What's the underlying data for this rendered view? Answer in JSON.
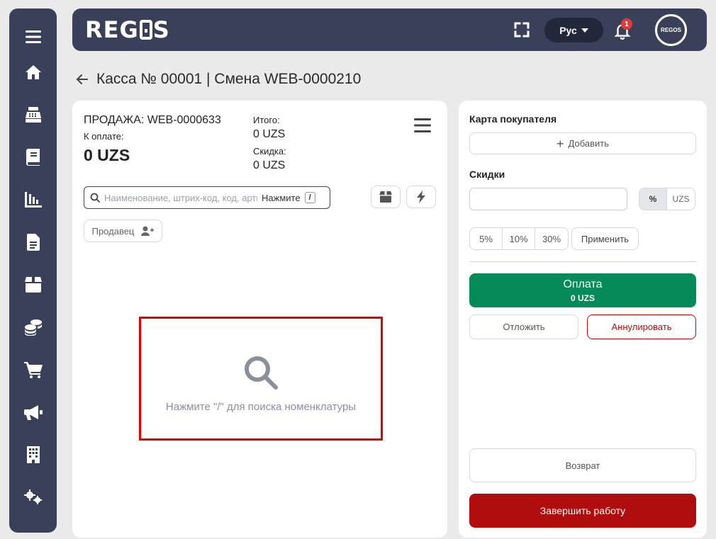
{
  "header": {
    "logo": "REG S",
    "language": "Рус",
    "notifications_count": "1",
    "avatar_text": "REGOS"
  },
  "page": {
    "title": "Касса № 00001 | Смена WEB-0000210"
  },
  "sale": {
    "number": "ПРОДАЖА: WEB-0000633",
    "to_pay_label": "К оплате:",
    "to_pay_value": "0 UZS",
    "total_label": "Итого:",
    "total_value": "0 UZS",
    "discount_label": "Скидка:",
    "discount_value": "0 UZS"
  },
  "search": {
    "placeholder": "Наименование, штрих-код, код, артикул",
    "hint": "Нажмите",
    "shortcut": "/"
  },
  "seller": {
    "label": "Продавец"
  },
  "empty_state": {
    "text": "Нажмите \"/\" для поиска номенклатуры"
  },
  "customer_card": {
    "label": "Карта покупателя",
    "add_button": "Добавить"
  },
  "discounts": {
    "label": "Скидки",
    "input_value": "",
    "mode_percent": "%",
    "mode_currency": "UZS",
    "presets": [
      "5%",
      "10%",
      "30%"
    ],
    "apply_button": "Применить"
  },
  "payment": {
    "pay_label": "Оплата",
    "pay_amount": "0 UZS",
    "postpone_button": "Отложить",
    "cancel_button": "Аннулировать",
    "return_button": "Возврат",
    "finish_button": "Завершить работу"
  },
  "colors": {
    "nav_bg": "#3a4059",
    "pay_green": "#058a5a",
    "finish_red": "#b00e0e",
    "cancel_red": "#b00e0e",
    "highlight_border": "#e00000"
  },
  "sidebar": {
    "icons": [
      "menu-icon",
      "home-icon",
      "cash-register-icon",
      "book-icon",
      "chart-icon",
      "document-icon",
      "box-icon",
      "coins-icon",
      "cart-icon",
      "megaphone-icon",
      "building-icon",
      "settings-icon"
    ]
  }
}
